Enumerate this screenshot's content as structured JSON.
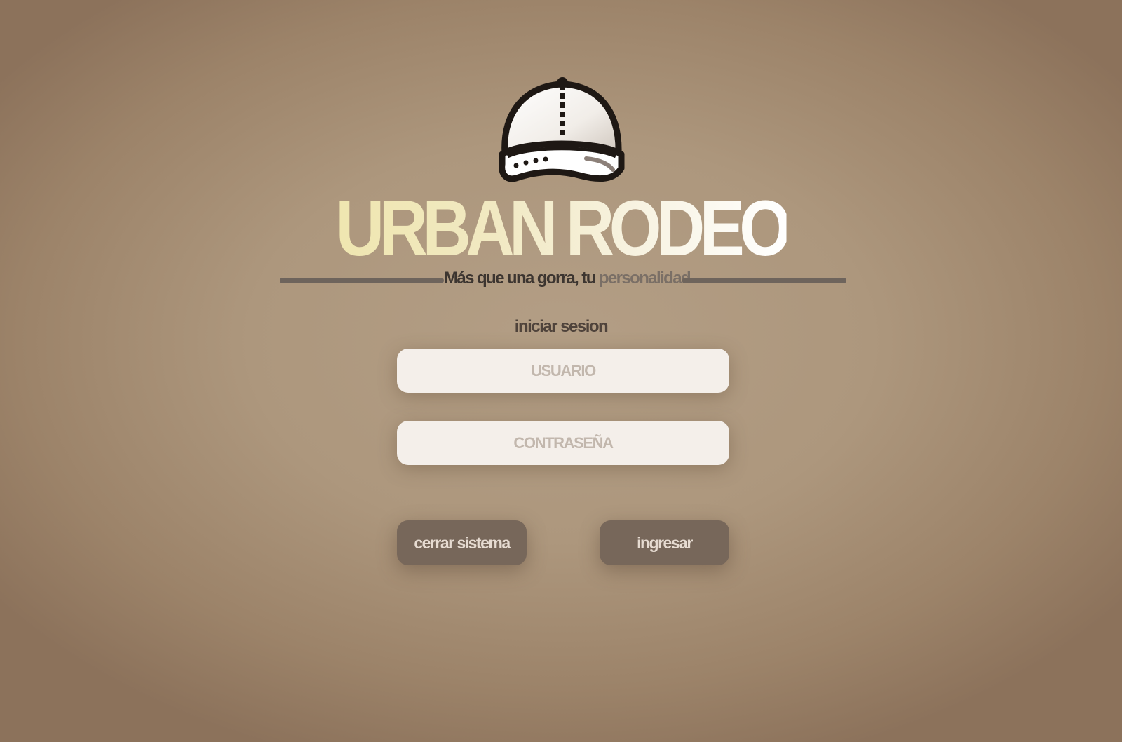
{
  "brand": {
    "logo_icon": "baseball-cap-icon",
    "name": "URBAN RODEO",
    "tagline_part1": "Más que una gorra, tu ",
    "tagline_part2": "personalidad"
  },
  "login": {
    "title": "iniciar sesion",
    "username_placeholder": "USUARIO",
    "password_placeholder": "CONTRASEÑA",
    "close_label": "cerrar sistema",
    "submit_label": "ingresar"
  },
  "colors": {
    "background": "#ad977d",
    "button": "#77675a",
    "field": "#f4efea",
    "title_gradient_start": "#efe6b0",
    "title_gradient_end": "#ffffff"
  }
}
